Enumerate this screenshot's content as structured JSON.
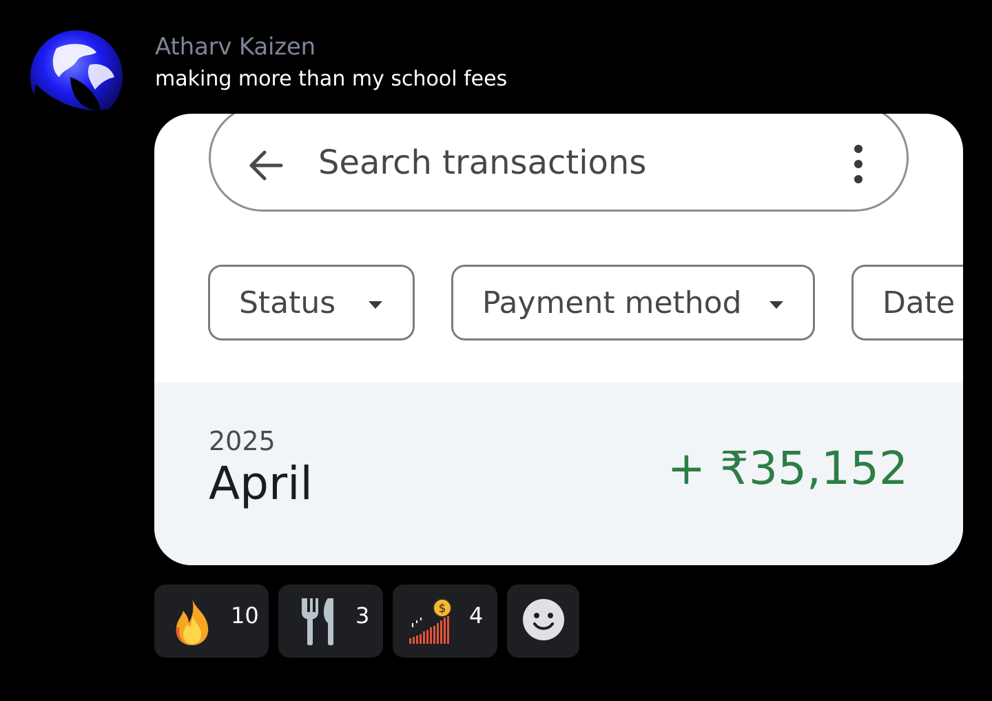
{
  "message": {
    "author": "Atharv Kaizen",
    "text": "making more than my school fees"
  },
  "attachment": {
    "search": {
      "placeholder": "Search transactions",
      "back_icon": "arrow-left-icon",
      "menu_icon": "more-vertical-icon"
    },
    "filters": [
      {
        "label": "Status"
      },
      {
        "label": "Payment method"
      },
      {
        "label": "Date"
      }
    ],
    "section": {
      "year": "2025",
      "month": "April",
      "total": "+ ₹35,152",
      "total_color": "#2e7d46"
    }
  },
  "reactions": [
    {
      "emoji": "fire",
      "count": "10"
    },
    {
      "emoji": "fork-and-knife",
      "count": "3"
    },
    {
      "emoji": "stonks-chart-coin",
      "count": "4"
    },
    {
      "emoji": "add-reaction-icon",
      "count": ""
    }
  ],
  "colors": {
    "background": "#000000",
    "author": "#7d8697",
    "reaction_bg": "#1e1f22",
    "accent_green": "#2e7d46"
  }
}
